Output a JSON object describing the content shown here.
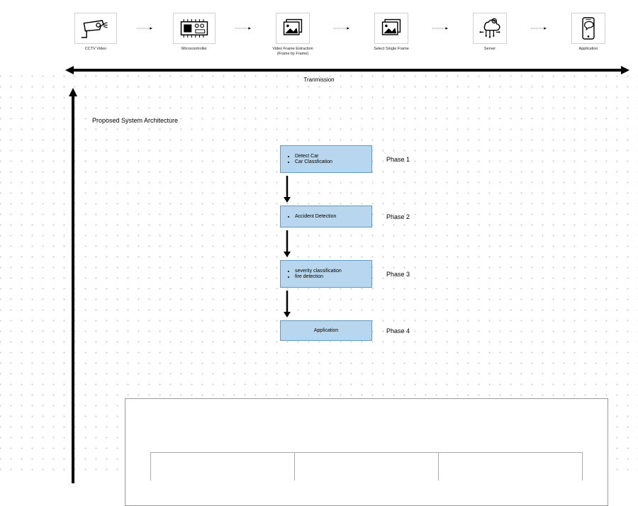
{
  "pipeline": [
    {
      "icon": "cctv-camera-icon",
      "label": "CCTV Video"
    },
    {
      "icon": "microcontroller-icon",
      "label": "Microcontroller"
    },
    {
      "icon": "frames-stack-icon",
      "label": "Video Frame Extraction (Frame by Frame)"
    },
    {
      "icon": "frames-stack-icon",
      "label": "Select Single Frame"
    },
    {
      "icon": "cloud-server-icon",
      "label": "Server"
    },
    {
      "icon": "mobile-chat-icon",
      "label": "Application"
    }
  ],
  "transmission_label": "Tranmission",
  "heading": "Proposed System Architecture",
  "phases": [
    {
      "label": "Phase 1",
      "items": [
        "Detect Car",
        "Car Classfication"
      ]
    },
    {
      "label": "Phase 2",
      "items": [
        "Accident Detection"
      ]
    },
    {
      "label": "Phase 3",
      "items": [
        "severity classification",
        "fire detection"
      ]
    }
  ],
  "phase4": {
    "label": "Phase 4",
    "title": "Application"
  }
}
